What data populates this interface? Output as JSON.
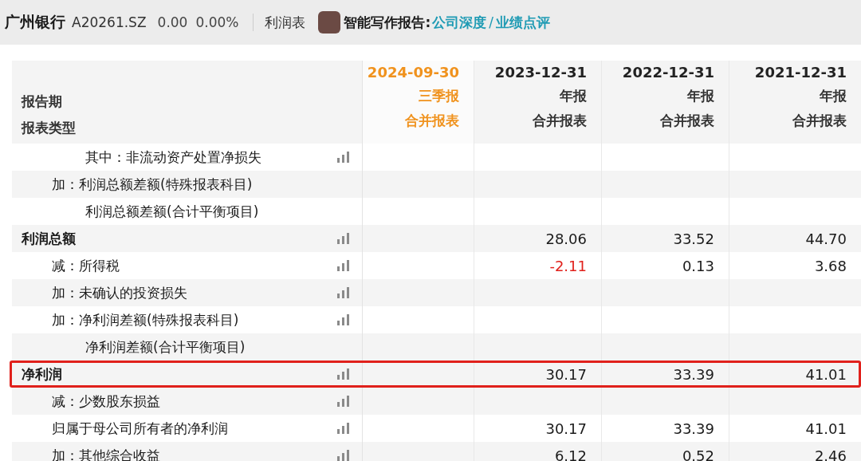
{
  "top_bar": {
    "stock_name": "广州银行",
    "code": "A20261.SZ",
    "price": "0.00",
    "change": "0.00%",
    "statement": "利润表",
    "report_label": "智能写作报告:",
    "report_links": [
      "公司深度",
      "业绩点评"
    ],
    "link_separator": "/"
  },
  "table": {
    "header_labels": [
      "报告期",
      "报表类型"
    ],
    "columns": [
      {
        "date": "2024-09-30",
        "period": "三季报",
        "type": "合并报表",
        "selected": true
      },
      {
        "date": "2023-12-31",
        "period": "年报",
        "type": "合并报表",
        "selected": false
      },
      {
        "date": "2022-12-31",
        "period": "年报",
        "type": "合并报表",
        "selected": false
      },
      {
        "date": "2021-12-31",
        "period": "年报",
        "type": "合并报表",
        "selected": false
      }
    ],
    "rows": [
      {
        "label": "其中：非流动资产处置净损失",
        "kind": "sub",
        "chart_icon": true,
        "highlighted": false,
        "cells": [
          null,
          null,
          null,
          null
        ]
      },
      {
        "label": "加：利润总额差额(特殊报表科目)",
        "kind": "item",
        "chart_icon": false,
        "highlighted": false,
        "cells": [
          null,
          null,
          null,
          null
        ]
      },
      {
        "label": "利润总额差额(合计平衡项目)",
        "kind": "cont",
        "chart_icon": false,
        "highlighted": false,
        "cells": [
          null,
          null,
          null,
          null
        ]
      },
      {
        "label": "利润总额",
        "kind": "total",
        "chart_icon": true,
        "highlighted": false,
        "cells": [
          null,
          {
            "text": "28.06",
            "color": "#1a1a1a"
          },
          {
            "text": "33.52",
            "color": "#1a1a1a"
          },
          {
            "text": "44.70",
            "color": "#1a1a1a"
          }
        ]
      },
      {
        "label": "减：所得税",
        "kind": "item",
        "chart_icon": true,
        "highlighted": false,
        "cells": [
          null,
          {
            "text": "-2.11",
            "color": "#e0201b"
          },
          {
            "text": "0.13",
            "color": "#1a1a1a"
          },
          {
            "text": "3.68",
            "color": "#1a1a1a"
          }
        ]
      },
      {
        "label": "加：未确认的投资损失",
        "kind": "item",
        "chart_icon": true,
        "highlighted": false,
        "cells": [
          null,
          null,
          null,
          null
        ]
      },
      {
        "label": "加：净利润差额(特殊报表科目)",
        "kind": "item",
        "chart_icon": true,
        "highlighted": false,
        "cells": [
          null,
          null,
          null,
          null
        ]
      },
      {
        "label": "净利润差额(合计平衡项目)",
        "kind": "cont",
        "chart_icon": false,
        "highlighted": false,
        "cells": [
          null,
          null,
          null,
          null
        ]
      },
      {
        "label": "净利润",
        "kind": "total",
        "chart_icon": true,
        "highlighted": true,
        "cells": [
          null,
          {
            "text": "30.17",
            "color": "#1a1a1a"
          },
          {
            "text": "33.39",
            "color": "#1a1a1a"
          },
          {
            "text": "41.01",
            "color": "#1a1a1a"
          }
        ]
      },
      {
        "label": "减：少数股东损益",
        "kind": "item",
        "chart_icon": true,
        "highlighted": false,
        "cells": [
          null,
          null,
          null,
          null
        ]
      },
      {
        "label": "归属于母公司所有者的净利润",
        "kind": "item",
        "chart_icon": true,
        "highlighted": false,
        "cells": [
          null,
          {
            "text": "30.17",
            "color": "#1a1a1a"
          },
          {
            "text": "33.39",
            "color": "#1a1a1a"
          },
          {
            "text": "41.01",
            "color": "#1a1a1a"
          }
        ]
      },
      {
        "label": "加：其他综合收益",
        "kind": "item",
        "chart_icon": true,
        "highlighted": false,
        "cells": [
          null,
          {
            "text": "6.12",
            "color": "#1a1a1a"
          },
          {
            "text": "0.52",
            "color": "#1a1a1a"
          },
          {
            "text": "2.46",
            "color": "#1a1a1a"
          }
        ]
      }
    ]
  }
}
